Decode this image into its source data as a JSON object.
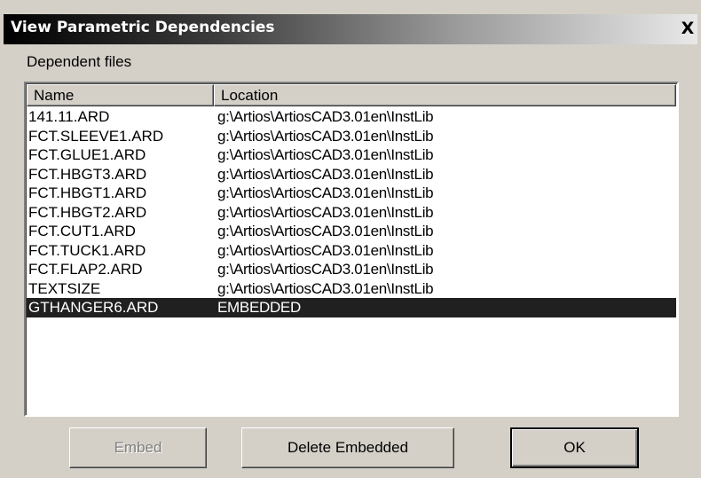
{
  "window": {
    "title": "View Parametric Dependencies",
    "close_label": "X"
  },
  "dependent_files_label": "Dependent files",
  "list": {
    "columns": [
      "Name",
      "Location"
    ],
    "rows": [
      {
        "name": "141.11.ARD",
        "location": "g:\\Artios\\ArtiosCAD3.01en\\InstLib"
      },
      {
        "name": "FCT.SLEEVE1.ARD",
        "location": "g:\\Artios\\ArtiosCAD3.01en\\InstLib"
      },
      {
        "name": "FCT.GLUE1.ARD",
        "location": "g:\\Artios\\ArtiosCAD3.01en\\InstLib"
      },
      {
        "name": "FCT.HBGT3.ARD",
        "location": "g:\\Artios\\ArtiosCAD3.01en\\InstLib"
      },
      {
        "name": "FCT.HBGT1.ARD",
        "location": "g:\\Artios\\ArtiosCAD3.01en\\InstLib"
      },
      {
        "name": "FCT.HBGT2.ARD",
        "location": "g:\\Artios\\ArtiosCAD3.01en\\InstLib"
      },
      {
        "name": "FCT.CUT1.ARD",
        "location": "g:\\Artios\\ArtiosCAD3.01en\\InstLib"
      },
      {
        "name": "FCT.TUCK1.ARD",
        "location": "g:\\Artios\\ArtiosCAD3.01en\\InstLib"
      },
      {
        "name": "FCT.FLAP2.ARD",
        "location": "g:\\Artios\\ArtiosCAD3.01en\\InstLib"
      },
      {
        "name": "TEXTSIZE",
        "location": "g:\\Artios\\ArtiosCAD3.01en\\InstLib"
      },
      {
        "name": "GTHANGER6.ARD",
        "location": "EMBEDDED",
        "selected": true
      }
    ]
  },
  "buttons": {
    "embed": "Embed",
    "delete_embedded": "Delete Embedded",
    "ok": "OK"
  }
}
